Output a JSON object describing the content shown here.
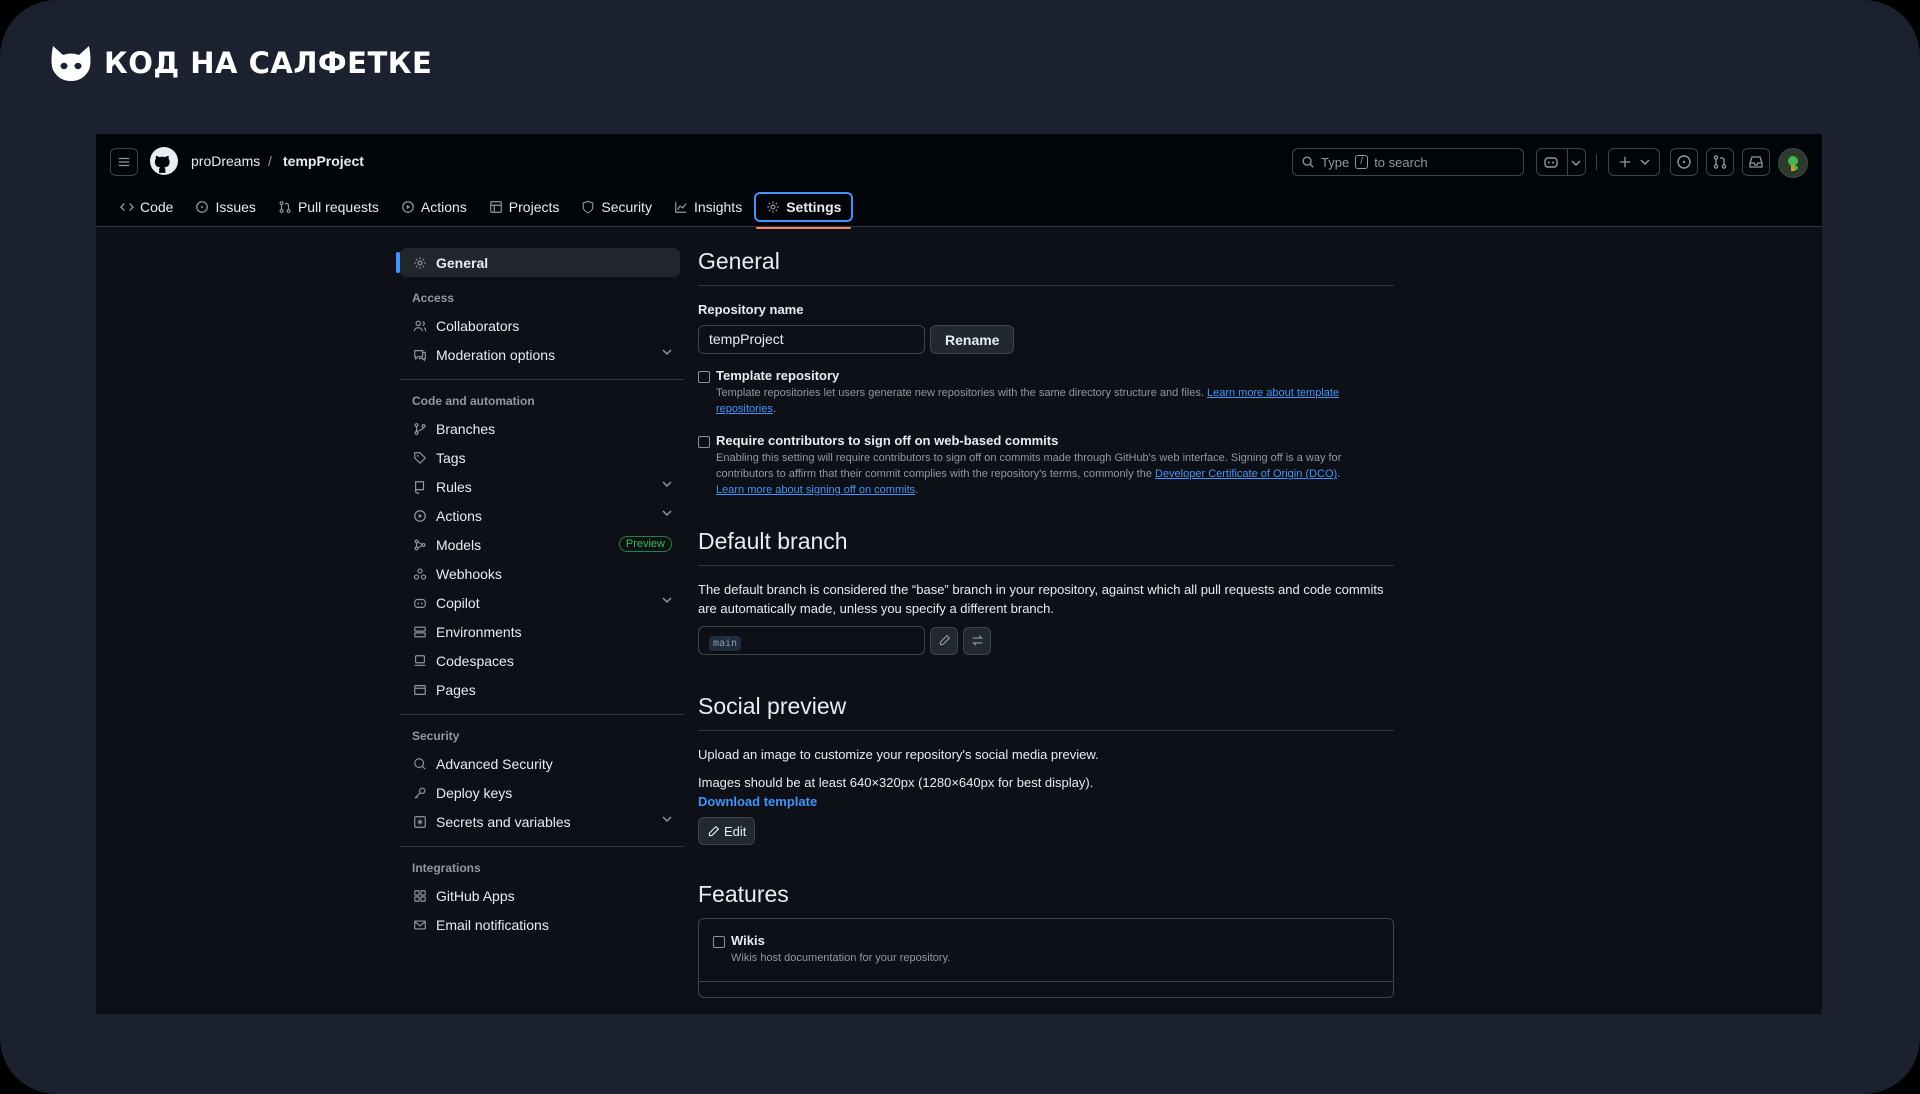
{
  "brand": {
    "title": "КОД НА САЛФЕТКЕ"
  },
  "header": {
    "owner": "proDreams",
    "separator": "/",
    "repo": "tempProject",
    "search": {
      "prefix": "Type",
      "key": "/",
      "suffix": "to search"
    }
  },
  "tabs": [
    {
      "label": "Code",
      "icon": "code-icon"
    },
    {
      "label": "Issues",
      "icon": "issue-icon"
    },
    {
      "label": "Pull requests",
      "icon": "pull-request-icon"
    },
    {
      "label": "Actions",
      "icon": "play-icon"
    },
    {
      "label": "Projects",
      "icon": "table-icon"
    },
    {
      "label": "Security",
      "icon": "shield-icon"
    },
    {
      "label": "Insights",
      "icon": "graph-icon"
    },
    {
      "label": "Settings",
      "icon": "gear-icon",
      "active": true
    }
  ],
  "sidebar": {
    "general": "General",
    "access": {
      "title": "Access",
      "items": [
        "Collaborators",
        "Moderation options"
      ]
    },
    "code_automation": {
      "title": "Code and automation",
      "items": [
        "Branches",
        "Tags",
        "Rules",
        "Actions",
        "Models",
        "Webhooks",
        "Copilot",
        "Environments",
        "Codespaces",
        "Pages"
      ],
      "models_badge": "Preview"
    },
    "security": {
      "title": "Security",
      "items": [
        "Advanced Security",
        "Deploy keys",
        "Secrets and variables"
      ]
    },
    "integrations": {
      "title": "Integrations",
      "items": [
        "GitHub Apps",
        "Email notifications"
      ]
    }
  },
  "main": {
    "general": {
      "title": "General",
      "repo_name_label": "Repository name",
      "repo_name_value": "tempProject",
      "rename_button": "Rename",
      "template": {
        "title": "Template repository",
        "desc": "Template repositories let users generate new repositories with the same directory structure and files.",
        "link1": "Learn more about template",
        "link2": "repositories",
        "end": "."
      },
      "signoff": {
        "title": "Require contributors to sign off on web-based commits",
        "desc": "Enabling this setting will require contributors to sign off on commits made through GitHub's web interface. Signing off is a way for contributors to affirm that their commit complies with the repository's terms, commonly the",
        "link_dco": "Developer Certificate of Origin (DCO)",
        "link_more": "Learn more about signing off on commits",
        "dot": "."
      }
    },
    "default_branch": {
      "title": "Default branch",
      "desc": "The default branch is considered the “base” branch in your repository, against which all pull requests and code commits are automatically made, unless you specify a different branch.",
      "branch": "main"
    },
    "social_preview": {
      "title": "Social preview",
      "desc1": "Upload an image to customize your repository's social media preview.",
      "desc2": "Images should be at least 640×320px (1280×640px for best display).",
      "download": "Download template",
      "edit_button": "Edit"
    },
    "features": {
      "title": "Features",
      "wikis_title": "Wikis",
      "wikis_desc": "Wikis host documentation for your repository."
    }
  },
  "colors": {
    "accent": "#4493f8",
    "active_tab_underline": "#f78166",
    "badge_green": "#3fb950"
  }
}
